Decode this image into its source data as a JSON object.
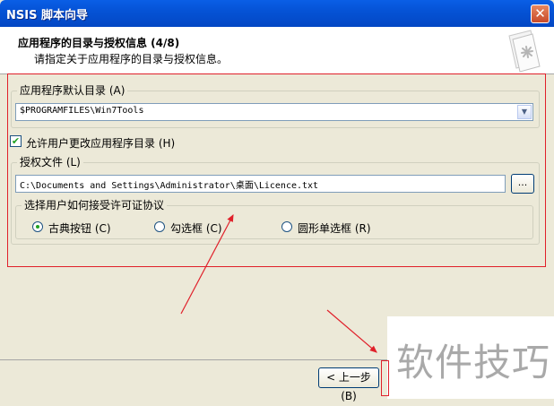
{
  "window": {
    "title": "NSIS 脚本向导",
    "close_glyph": "✕"
  },
  "header": {
    "title": "应用程序的目录与授权信息 (4/8)",
    "subtitle": "请指定关于应用程序的目录与授权信息。",
    "icon": "document-gear-icon"
  },
  "default_dir": {
    "legend": "应用程序默认目录 (A)",
    "value": "$PROGRAMFILES\\Win7Tools",
    "dropdown_glyph": "▼"
  },
  "allow_change": {
    "label": "允许用户更改应用程序目录 (H)",
    "checked": true,
    "check_glyph": "✔"
  },
  "license": {
    "legend": "授权文件 (L)",
    "value": "C:\\Documents and Settings\\Administrator\\桌面\\Licence.txt",
    "browse_label": "..."
  },
  "accept_method": {
    "legend": "选择用户如何接受许可证协议",
    "options": [
      {
        "label": "古典按钮 (C)",
        "selected": true
      },
      {
        "label": "勾选框 (C)",
        "selected": false
      },
      {
        "label": "圆形单选框 (R)",
        "selected": false
      }
    ]
  },
  "footer": {
    "back_label": "< 上一步 (B)"
  },
  "watermark": {
    "text": "软件技巧"
  },
  "colors": {
    "annotation": "#e0202a",
    "titlebar": "#0553d6",
    "check": "#21a121"
  }
}
